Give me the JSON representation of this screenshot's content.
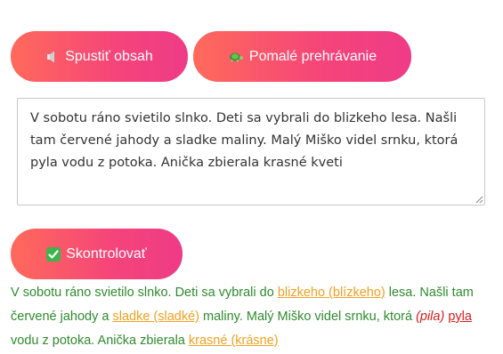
{
  "colors": {
    "button_gradient_start": "#ff6a5b",
    "button_gradient_end": "#ee3b86",
    "correct_text": "#2e8b2e",
    "warning_text": "#f0a020",
    "error_text": "#d81c1c"
  },
  "toolbar": {
    "play_icon": "speaker-icon",
    "play_label": "Spustiť obsah",
    "slow_icon": "turtle-icon",
    "slow_label": "Pomalé prehrávanie"
  },
  "editor": {
    "value": "V sobotu ráno svietilo slnko. Deti sa vybrali do blizkeho lesa. Našli tam červené jahody a sladke maliny. Malý Miško videl srnku, ktorá pyla vodu z potoka. Anička zbierala krasné kveti"
  },
  "check": {
    "icon": "check-mark-icon",
    "label": "Skontrolovať"
  },
  "result": {
    "seg1": "V sobotu ráno svietilo slnko. Deti sa vybrali do ",
    "err1": "blizkeho (blízkeho)",
    "seg2": " lesa. Našli tam červené jahody a ",
    "err2": "sladke (sladké)",
    "seg3": " maliny. Malý Miško videl srnku, ktorá ",
    "err3_original": "(pila)",
    "err3": "pyla",
    "seg4": " vodu z potoka. Anička zbierala ",
    "err4": "krasné (krásne)"
  }
}
